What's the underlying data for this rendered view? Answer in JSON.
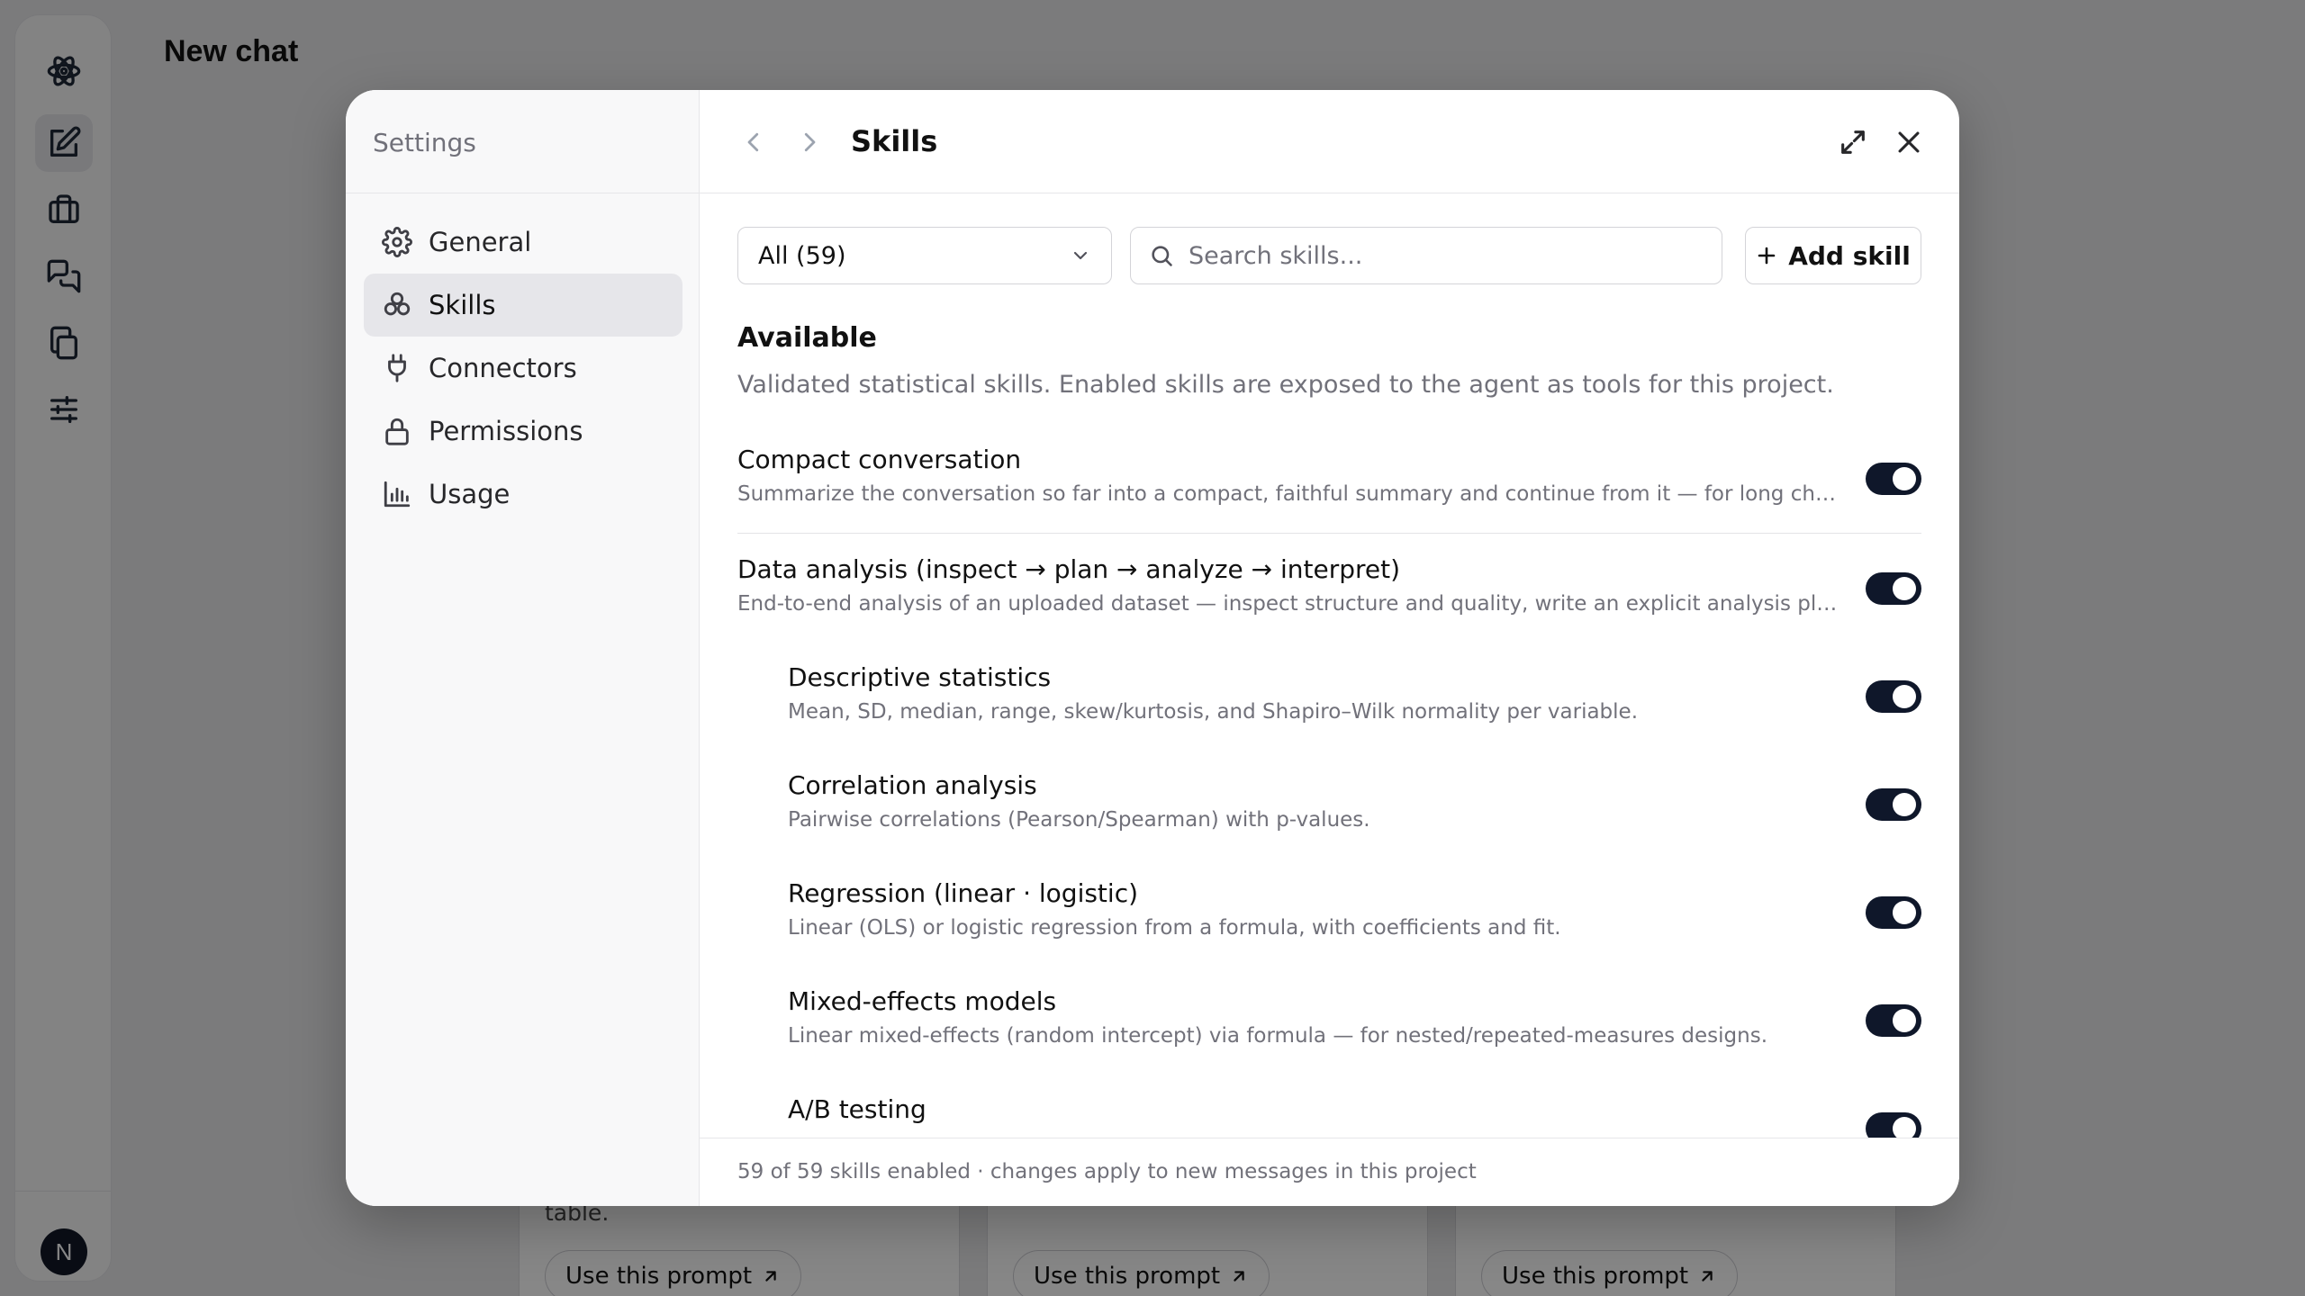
{
  "app": {
    "page_title": "New chat",
    "avatar_initial": "N"
  },
  "rail": {
    "items": [
      {
        "icon": "atom-icon"
      },
      {
        "icon": "compose-icon",
        "active": true
      },
      {
        "icon": "briefcase-icon"
      },
      {
        "icon": "chats-icon"
      },
      {
        "icon": "documents-icon"
      },
      {
        "icon": "sliders-icon"
      }
    ]
  },
  "background_cards": [
    {
      "tail_text": "table.",
      "button_label": "Use this prompt"
    },
    {
      "tail_text": "",
      "button_label": "Use this prompt"
    },
    {
      "tail_text": "",
      "button_label": "Use this prompt"
    }
  ],
  "settings": {
    "title": "Settings",
    "nav": [
      {
        "label": "General",
        "icon": "gear-icon"
      },
      {
        "label": "Skills",
        "icon": "skills-icon",
        "active": true
      },
      {
        "label": "Connectors",
        "icon": "plug-icon"
      },
      {
        "label": "Permissions",
        "icon": "lock-icon"
      },
      {
        "label": "Usage",
        "icon": "bar-chart-icon"
      }
    ]
  },
  "skills_panel": {
    "title": "Skills",
    "filter_value": "All (59)",
    "search_placeholder": "Search skills...",
    "add_label": "Add skill",
    "section_title": "Available",
    "section_desc": "Validated statistical skills. Enabled skills are exposed to the agent as tools for this project.",
    "skills": [
      {
        "name": "Compact conversation",
        "desc": "Summarize the conversation so far into a compact, faithful summary and continue from it — for long chats when context gets large.",
        "enabled": true,
        "child": false
      },
      {
        "name": "Data analysis (inspect → plan → analyze → interpret)",
        "desc": "End-to-end analysis of an uploaded dataset — inspect structure and quality, write an explicit analysis plan, clearly interpret results.",
        "enabled": true,
        "child": false
      },
      {
        "name": "Descriptive statistics",
        "desc": "Mean, SD, median, range, skew/kurtosis, and Shapiro–Wilk normality per variable.",
        "enabled": true,
        "child": true
      },
      {
        "name": "Correlation analysis",
        "desc": "Pairwise correlations (Pearson/Spearman) with p-values.",
        "enabled": true,
        "child": true
      },
      {
        "name": "Regression (linear · logistic)",
        "desc": "Linear (OLS) or logistic regression from a formula, with coefficients and fit.",
        "enabled": true,
        "child": true
      },
      {
        "name": "Mixed-effects models",
        "desc": "Linear mixed-effects (random intercept) via formula — for nested/repeated-measures designs.",
        "enabled": true,
        "child": true
      },
      {
        "name": "A/B testing",
        "desc": "",
        "enabled": true,
        "child": true
      }
    ],
    "footer": "59 of 59 skills enabled · changes apply to new messages in this project"
  }
}
